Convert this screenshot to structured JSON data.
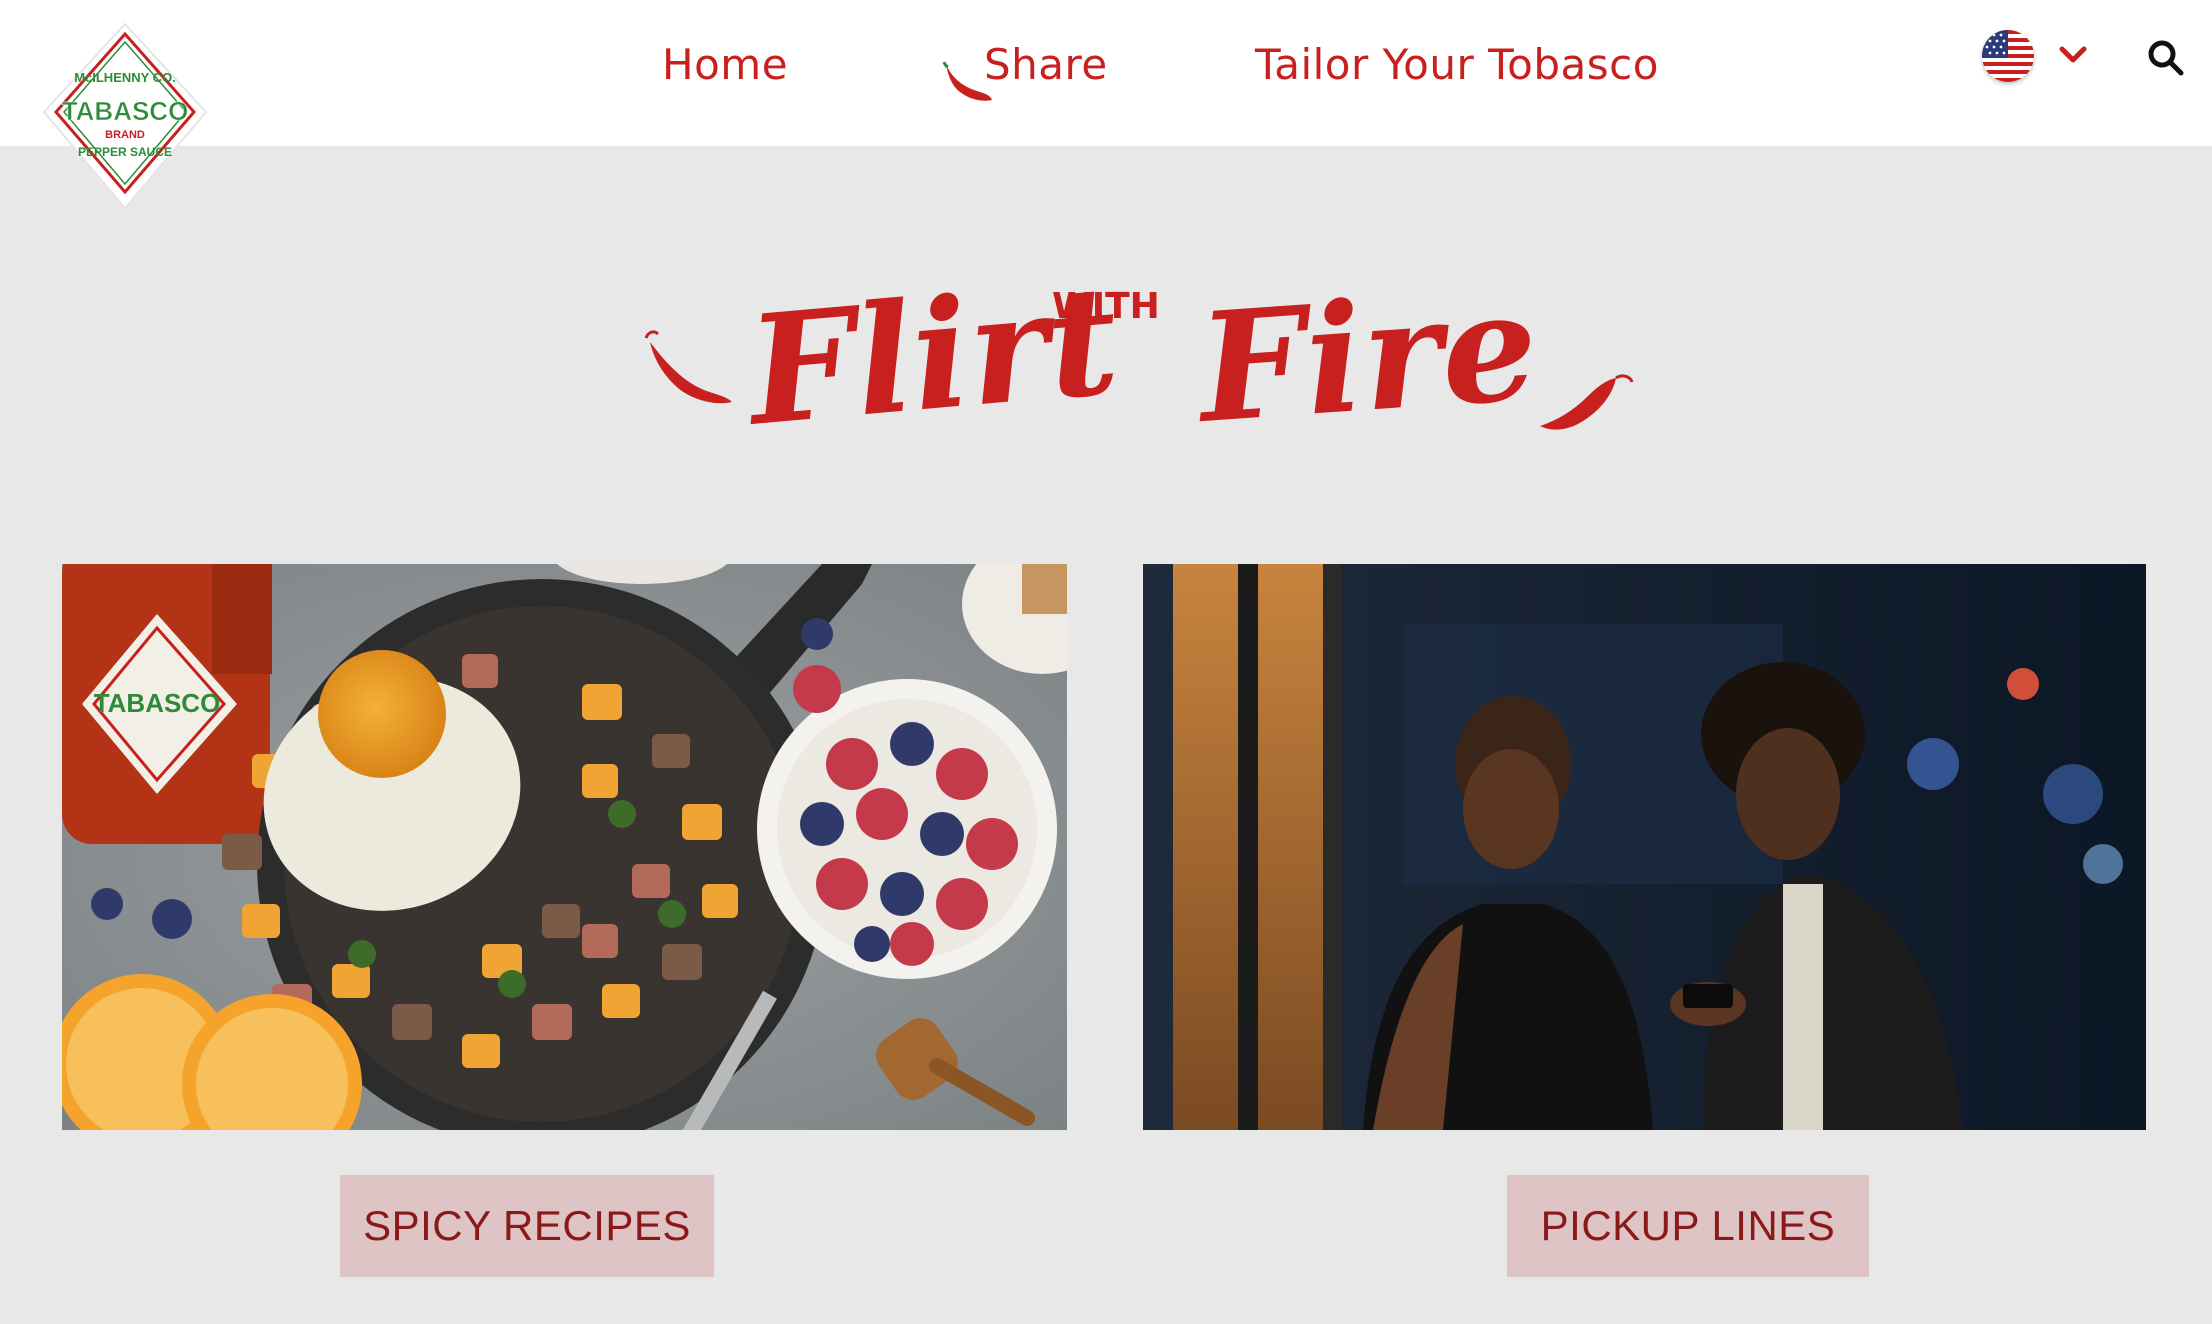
{
  "brand": {
    "logo_top": "McILHENNY CO.",
    "logo_word": "TABASCO",
    "logo_sub": "BRAND",
    "logo_bottom": "PEPPER SAUCE",
    "red": "#c8201e",
    "green": "#2e8b3a"
  },
  "nav": {
    "items": [
      {
        "label": "Home"
      },
      {
        "label": "Share"
      },
      {
        "label": "Tailor Your Tobasco"
      }
    ],
    "country_icon": "us-flag-icon",
    "search_icon": "search-icon"
  },
  "hero": {
    "title_part1": "Flirt",
    "title_connector": "WITH",
    "title_part2": "Fire"
  },
  "cards": [
    {
      "button_label": "SPICY RECIPES",
      "image": "breakfast-skillet-photo"
    },
    {
      "button_label": "PICKUP LINES",
      "image": "couple-at-night-photo"
    }
  ],
  "colors": {
    "background": "#e8e8e8",
    "button_bg": "#dec4c4",
    "button_text": "#8c1919"
  }
}
